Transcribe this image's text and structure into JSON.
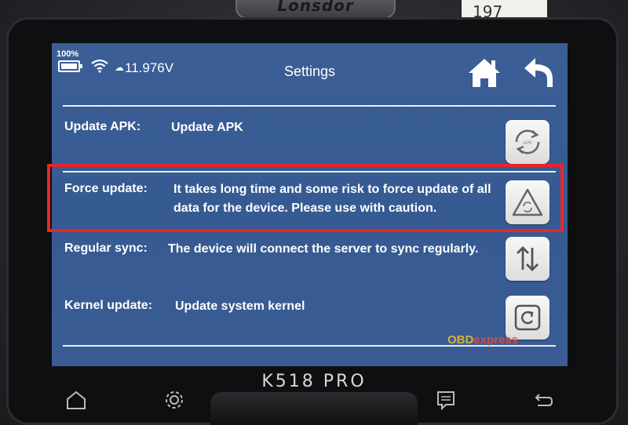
{
  "device": {
    "brand": "Lonsdor",
    "sticker": "197",
    "model": "K518 PRO"
  },
  "status_bar": {
    "battery_percent": "100%",
    "voltage": "11.976V",
    "title": "Settings"
  },
  "rows": [
    {
      "label": "Update APK:",
      "description": "Update APK",
      "button_icon": "update-apk-icon"
    },
    {
      "label": "Force update:",
      "description": "It takes long time and some risk to force update of all data for the device. Please use with caution.",
      "button_icon": "warning-refresh-icon"
    },
    {
      "label": "Regular sync:",
      "description": "The device will connect the server to sync regularly.",
      "button_icon": "sync-arrows-icon"
    },
    {
      "label": "Kernel update:",
      "description": "Update system kernel",
      "button_icon": "kernel-refresh-icon"
    }
  ],
  "highlight_color": "#e8262a",
  "watermark": {
    "prefix": "OBD",
    "suffix": "express"
  },
  "nav_bar": [
    "home-icon",
    "settings-icon",
    "message-icon",
    "back-icon"
  ]
}
